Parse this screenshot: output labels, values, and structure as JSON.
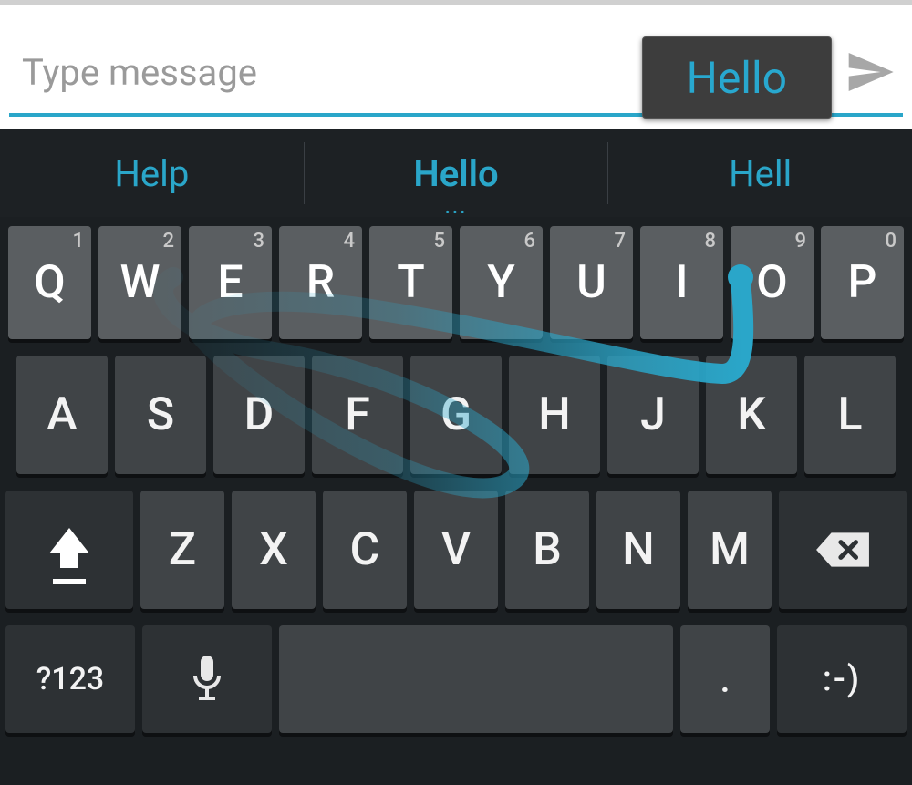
{
  "message_input": {
    "placeholder": "Type message",
    "value": ""
  },
  "prediction_tooltip": "Hello",
  "suggestions": {
    "left": "Help",
    "center": "Hello",
    "right": "Hell",
    "more_indicator": "..."
  },
  "colors": {
    "accent": "#2aa6c9",
    "key_top": "#5a5e61",
    "key_mid": "#404447",
    "key_dark": "#2d3134",
    "bg": "#1b1f22"
  },
  "keyboard": {
    "row1": [
      {
        "label": "Q",
        "sup": "1"
      },
      {
        "label": "W",
        "sup": "2"
      },
      {
        "label": "E",
        "sup": "3"
      },
      {
        "label": "R",
        "sup": "4"
      },
      {
        "label": "T",
        "sup": "5"
      },
      {
        "label": "Y",
        "sup": "6"
      },
      {
        "label": "U",
        "sup": "7"
      },
      {
        "label": "I",
        "sup": "8"
      },
      {
        "label": "O",
        "sup": "9"
      },
      {
        "label": "P",
        "sup": "0"
      }
    ],
    "row2": [
      "A",
      "S",
      "D",
      "F",
      "G",
      "H",
      "J",
      "K",
      "L"
    ],
    "row3": [
      "Z",
      "X",
      "C",
      "V",
      "B",
      "N",
      "M"
    ],
    "row4": {
      "symkey": "?123",
      "period": ".",
      "smile": ":-)"
    }
  }
}
